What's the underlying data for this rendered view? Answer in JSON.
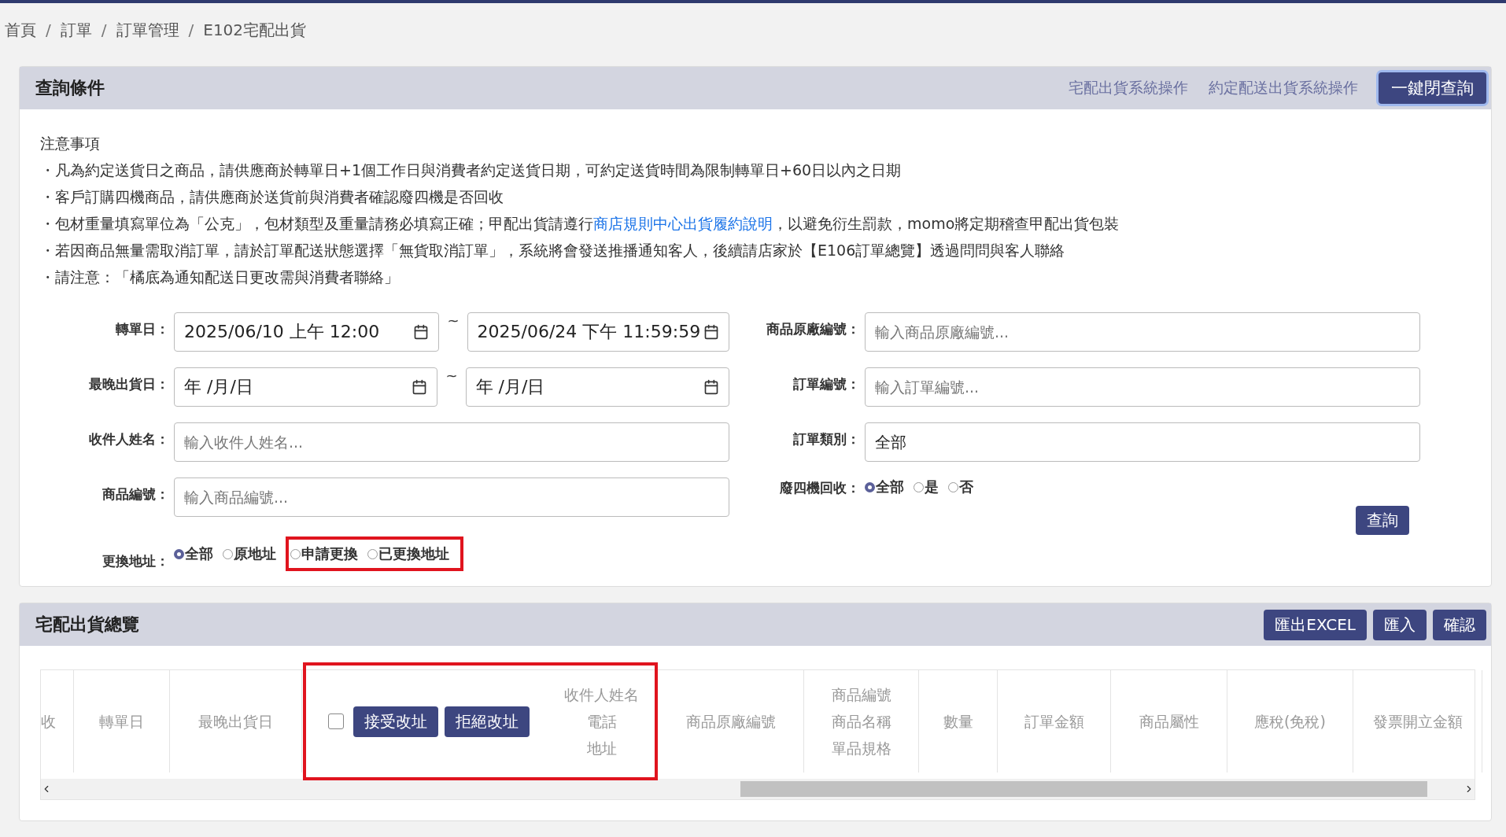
{
  "breadcrumb": [
    "首頁",
    "訂單",
    "訂單管理",
    "E102宅配出貨"
  ],
  "breadcrumb_separator": "/",
  "query_panel": {
    "title": "查詢條件",
    "links": [
      "宅配出貨系統操作",
      "約定配送出貨系統操作"
    ],
    "collapse_button": "一鍵閉查詢",
    "notes": {
      "title": "注意事項",
      "items": [
        {
          "text": "・凡為約定送貨日之商品，請供應商於轉單日+1個工作日與消費者約定送貨日期，可約定送貨時間為限制轉單日+60日以內之日期"
        },
        {
          "text": "・客戶訂購四機商品，請供應商於送貨前與消費者確認廢四機是否回收"
        },
        {
          "text": "・包材重量填寫單位為「公克」，包材類型及重量請務必填寫正確；甲配出貨請遵行",
          "link": "商店規則中心出貨履約說明",
          "after": "，以避免衍生罰款，momo將定期稽查甲配出貨包裝"
        },
        {
          "text": "・若因商品無量需取消訂單，請於訂單配送狀態選擇「無貨取消訂單」，系統將會發送推播通知客人，後續請店家於【E106訂單總覽】透過問問與客人聯絡"
        },
        {
          "text": "・請注意：「橘底為通知配送日更改需與消費者聯絡」"
        }
      ]
    },
    "left_fields": [
      {
        "kind": "date_range",
        "label": "轉單日：",
        "from": "2025/06/10 上午 12:00",
        "separator": "~",
        "to": "2025/06/24 下午 11:59:59"
      },
      {
        "kind": "date_range",
        "label": "最晚出貨日：",
        "from": "年 /月/日",
        "separator": "~",
        "to": "年 /月/日"
      },
      {
        "kind": "text",
        "label": "收件人姓名：",
        "placeholder": "輸入收件人姓名..."
      },
      {
        "kind": "text",
        "label": "商品編號：",
        "placeholder": "輸入商品編號..."
      },
      {
        "kind": "radio",
        "label": "更換地址：",
        "options": [
          {
            "label": "全部",
            "selected": true,
            "highlighted": false
          },
          {
            "label": "原地址",
            "selected": false,
            "highlighted": false
          },
          {
            "label": "申請更換",
            "selected": false,
            "highlighted": true
          },
          {
            "label": "已更換地址",
            "selected": false,
            "highlighted": true
          }
        ]
      }
    ],
    "right_fields": [
      {
        "kind": "text",
        "label": "商品原廠編號：",
        "placeholder": "輸入商品原廠編號..."
      },
      {
        "kind": "text",
        "label": "訂單編號：",
        "placeholder": "輸入訂單編號..."
      },
      {
        "kind": "select",
        "label": "訂單類別：",
        "value": "全部"
      },
      {
        "kind": "radio",
        "label": "廢四機回收：",
        "options": [
          {
            "label": "全部",
            "selected": true,
            "highlighted": false
          },
          {
            "label": "是",
            "selected": false,
            "highlighted": false
          },
          {
            "label": "否",
            "selected": false,
            "highlighted": false
          }
        ]
      }
    ],
    "search_button": "查詢"
  },
  "overview_panel": {
    "title": "宅配出貨總覽",
    "buttons": [
      "匯出EXCEL",
      "匯入",
      "確認"
    ],
    "table": {
      "columns": [
        {
          "kind": "text",
          "lines": [
            "收"
          ]
        },
        {
          "kind": "text",
          "lines": [
            "轉單日"
          ]
        },
        {
          "kind": "text",
          "lines": [
            "最晚出貨日"
          ]
        },
        {
          "kind": "actions",
          "checked": false,
          "buttons": [
            "接受改址",
            "拒絕改址"
          ],
          "lines": [
            "收件人姓名",
            "電話",
            "地址"
          ],
          "highlighted": true
        },
        {
          "kind": "text",
          "lines": [
            "商品原廠編號"
          ]
        },
        {
          "kind": "text",
          "lines": [
            "商品編號",
            "商品名稱",
            "單品規格"
          ]
        },
        {
          "kind": "text",
          "lines": [
            "數量"
          ]
        },
        {
          "kind": "text",
          "lines": [
            "訂單金額"
          ]
        },
        {
          "kind": "text",
          "lines": [
            "商品屬性"
          ]
        },
        {
          "kind": "text",
          "lines": [
            "應稅(免稅)"
          ]
        },
        {
          "kind": "text",
          "lines": [
            "發票開立金額"
          ]
        }
      ]
    }
  }
}
